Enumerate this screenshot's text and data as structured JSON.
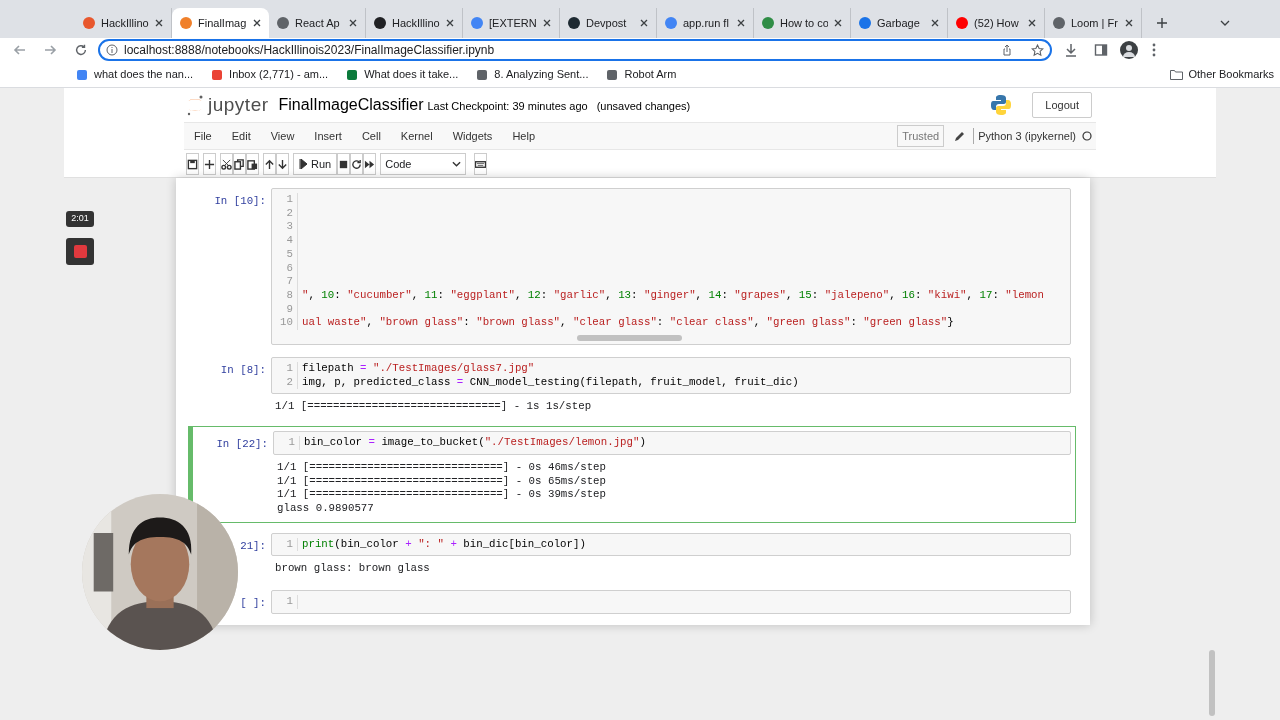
{
  "browser": {
    "tabs": [
      {
        "label": "HackIllino",
        "selected": false,
        "color": "#e8572d"
      },
      {
        "label": "FinalImag",
        "selected": true,
        "color": "#f0802a"
      },
      {
        "label": "React Ap",
        "selected": false,
        "color": "#5f6368"
      },
      {
        "label": "HackIllino",
        "selected": false,
        "color": "#202124"
      },
      {
        "label": "[EXTERN",
        "selected": false,
        "color": "#4285f4"
      },
      {
        "label": "Devpost",
        "selected": false,
        "color": "#1e2a32"
      },
      {
        "label": "app.run fl",
        "selected": false,
        "color": "#4285f4"
      },
      {
        "label": "How to co",
        "selected": false,
        "color": "#2f8d46"
      },
      {
        "label": "Garbage",
        "selected": false,
        "color": "#1a73e8"
      },
      {
        "label": "(52) How",
        "selected": false,
        "color": "#ff0000"
      },
      {
        "label": "Loom | Fr",
        "selected": false,
        "color": "#5f6368"
      }
    ],
    "address": "localhost:8888/notebooks/HackIllinois2023/FinalImageClassifier.ipynb",
    "bookmarks": [
      {
        "label": "what does the nan...",
        "color": "#4285f4"
      },
      {
        "label": "Inbox (2,771) - am...",
        "color": "#ea4335"
      },
      {
        "label": "What does it take...",
        "color": "#0b7a3b"
      },
      {
        "label": "8. Analyzing Sent...",
        "color": "#5f6368"
      },
      {
        "label": "Robot Arm",
        "color": "#5f6368"
      }
    ],
    "other_bookmarks": "Other Bookmarks"
  },
  "recorder": {
    "time": "2:01"
  },
  "jupyter": {
    "logo": "jupyter",
    "title": "FinalImageClassifier",
    "checkpoint": "Last Checkpoint: 39 minutes ago",
    "unsaved": "(unsaved changes)",
    "logout": "Logout",
    "menu": [
      "File",
      "Edit",
      "View",
      "Insert",
      "Cell",
      "Kernel",
      "Widgets",
      "Help"
    ],
    "trusted": "Trusted",
    "kernel": "Python 3 (ipykernel)",
    "run": "Run",
    "cell_type": "Code"
  },
  "cells": [
    {
      "prompt": "In [10]:",
      "selected": false,
      "scrollbar": true,
      "lines": [
        {
          "number": "1"
        },
        {
          "number": "2"
        },
        {
          "number": "3"
        },
        {
          "number": "4"
        },
        {
          "number": "5"
        },
        {
          "number": "6"
        },
        {
          "number": "7"
        },
        {
          "number": "8",
          "tokens": [
            {
              "kind": "s",
              "text": "\""
            },
            {
              "kind": "p",
              "text": ", "
            },
            {
              "kind": "n",
              "text": "10"
            },
            {
              "kind": "p",
              "text": ": "
            },
            {
              "kind": "s",
              "text": "\"cucumber\""
            },
            {
              "kind": "p",
              "text": ", "
            },
            {
              "kind": "n",
              "text": "11"
            },
            {
              "kind": "p",
              "text": ": "
            },
            {
              "kind": "s",
              "text": "\"eggplant\""
            },
            {
              "kind": "p",
              "text": ", "
            },
            {
              "kind": "n",
              "text": "12"
            },
            {
              "kind": "p",
              "text": ": "
            },
            {
              "kind": "s",
              "text": "\"garlic\""
            },
            {
              "kind": "p",
              "text": ", "
            },
            {
              "kind": "n",
              "text": "13"
            },
            {
              "kind": "p",
              "text": ": "
            },
            {
              "kind": "s",
              "text": "\"ginger\""
            },
            {
              "kind": "p",
              "text": ", "
            },
            {
              "kind": "n",
              "text": "14"
            },
            {
              "kind": "p",
              "text": ": "
            },
            {
              "kind": "s",
              "text": "\"grapes\""
            },
            {
              "kind": "p",
              "text": ", "
            },
            {
              "kind": "n",
              "text": "15"
            },
            {
              "kind": "p",
              "text": ": "
            },
            {
              "kind": "s",
              "text": "\"jalepeno\""
            },
            {
              "kind": "p",
              "text": ", "
            },
            {
              "kind": "n",
              "text": "16"
            },
            {
              "kind": "p",
              "text": ": "
            },
            {
              "kind": "s",
              "text": "\"kiwi\""
            },
            {
              "kind": "p",
              "text": ", "
            },
            {
              "kind": "n",
              "text": "17"
            },
            {
              "kind": "p",
              "text": ": "
            },
            {
              "kind": "s",
              "text": "\"lemon"
            }
          ]
        },
        {
          "number": "9"
        },
        {
          "number": "10",
          "tokens": [
            {
              "kind": "s",
              "text": "ual waste\""
            },
            {
              "kind": "p",
              "text": ", "
            },
            {
              "kind": "s",
              "text": "\"brown glass\""
            },
            {
              "kind": "p",
              "text": ": "
            },
            {
              "kind": "s",
              "text": "\"brown glass\""
            },
            {
              "kind": "p",
              "text": ", "
            },
            {
              "kind": "s",
              "text": "\"clear glass\""
            },
            {
              "kind": "p",
              "text": ": "
            },
            {
              "kind": "s",
              "text": "\"clear class\""
            },
            {
              "kind": "p",
              "text": ", "
            },
            {
              "kind": "s",
              "text": "\"green glass\""
            },
            {
              "kind": "p",
              "text": ": "
            },
            {
              "kind": "s",
              "text": "\"green glass\""
            },
            {
              "kind": "p",
              "text": "}"
            }
          ]
        }
      ]
    },
    {
      "prompt": "In [8]:",
      "selected": false,
      "lines": [
        {
          "number": "1",
          "tokens": [
            {
              "kind": "p",
              "text": "filepath "
            },
            {
              "kind": "o",
              "text": "="
            },
            {
              "kind": "s",
              "text": " \"./TestImages/glass7.jpg\""
            }
          ]
        },
        {
          "number": "2",
          "tokens": [
            {
              "kind": "p",
              "text": "img, p, predicted_class "
            },
            {
              "kind": "o",
              "text": "="
            },
            {
              "kind": "p",
              "text": " CNN_model_testing(filepath, fruit_model, fruit_dic)"
            }
          ]
        }
      ],
      "outputs": [
        "1/1 [==============================] - 1s 1s/step"
      ]
    },
    {
      "prompt": "In [22]:",
      "selected": true,
      "lines": [
        {
          "number": "1",
          "tokens": [
            {
              "kind": "p",
              "text": "bin_color "
            },
            {
              "kind": "o",
              "text": "="
            },
            {
              "kind": "p",
              "text": " image_to_bucket("
            },
            {
              "kind": "s",
              "text": "\"./TestImages/lemon.jpg\""
            },
            {
              "kind": "p",
              "text": ")"
            }
          ]
        }
      ],
      "outputs": [
        "1/1 [==============================] - 0s 46ms/step",
        "1/1 [==============================] - 0s 65ms/step",
        "1/1 [==============================] - 0s 39ms/step",
        "glass 0.9890577"
      ]
    },
    {
      "prompt": "21]:",
      "selected": false,
      "lines": [
        {
          "number": "1",
          "tokens": [
            {
              "kind": "b",
              "text": "print"
            },
            {
              "kind": "p",
              "text": "(bin_color "
            },
            {
              "kind": "o",
              "text": "+"
            },
            {
              "kind": "s",
              "text": " \": \""
            },
            {
              "kind": "o",
              "text": " +"
            },
            {
              "kind": "p",
              "text": " bin_dic[bin_color])"
            }
          ]
        }
      ],
      "outputs": [
        "brown glass: brown glass"
      ]
    },
    {
      "prompt": "[ ]:",
      "selected": false,
      "lines": [
        {
          "number": "1"
        }
      ]
    }
  ]
}
